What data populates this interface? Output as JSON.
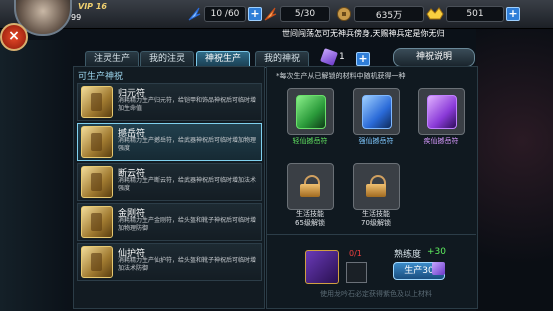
{
  "header": {
    "vip": "VIP 16",
    "level": "99",
    "resources": [
      {
        "icon": "stamina-feather-icon",
        "value": "10 /60"
      },
      {
        "icon": "energy-feather-icon",
        "value": "5/30"
      },
      {
        "icon": "coin-icon",
        "value": "635万"
      },
      {
        "icon": "gold-ingot-icon",
        "value": "501"
      }
    ],
    "ticker": "世间闯荡怎可无神兵傍身,天赐神兵定是你无归"
  },
  "tabs": [
    {
      "label": "注灵生产",
      "active": false
    },
    {
      "label": "我的注灵",
      "active": false
    },
    {
      "label": "神祝生产",
      "active": true
    },
    {
      "label": "我的神祝",
      "active": false
    }
  ],
  "jade": {
    "value": "1"
  },
  "prayer_button": "神祝说明",
  "left_panel": {
    "title": "可生产神祝",
    "items": [
      {
        "name": "归元符",
        "desc": "消耗精力生产归元符，给铠甲和饰品神祝后可临时增加生命值"
      },
      {
        "name": "撼岳符",
        "desc": "消耗精力生产撼岳符，给武器神祝后可临时增加物理强度"
      },
      {
        "name": "断云符",
        "desc": "消耗精力生产断云符，给武器神祝后可临时增加法术强度"
      },
      {
        "name": "金刚符",
        "desc": "消耗精力生产金刚符，给头盔和靴子神祝后可临时增加物理防御"
      },
      {
        "name": "仙护符",
        "desc": "消耗精力生产仙护符，给头盔和靴子神祝后可临时增加法术防御"
      }
    ]
  },
  "right_panel": {
    "tip": "*每次生产从已解锁的材料中随机获得一种",
    "outputs": [
      {
        "label": "轻仙撼岳符",
        "color": "#5fe05f",
        "tint": "#2a9a3a"
      },
      {
        "label": "强仙撼岳符",
        "color": "#7fc8ff",
        "tint": "#2a6ad8"
      },
      {
        "label": "疾仙撼岳符",
        "color": "#d89aff",
        "tint": "#8a3ad8"
      }
    ],
    "locked": [
      {
        "line1": "生活技能",
        "line2": "65级解锁"
      },
      {
        "line1": "生活技能",
        "line2": "70级解锁"
      }
    ],
    "material_count": "0/1",
    "proficiency_label": "熟练度",
    "proficiency_value": "+30",
    "produce_button": "生产30",
    "hint": "使用龙吟石必定获得紫色及以上材料"
  }
}
